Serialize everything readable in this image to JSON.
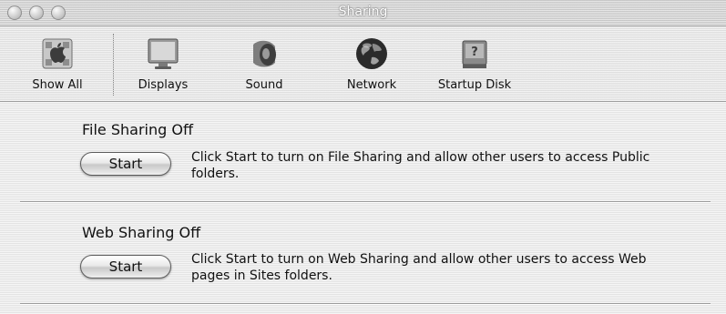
{
  "window": {
    "title": "Sharing"
  },
  "toolbar": {
    "items": [
      {
        "label": "Show All",
        "icon": "apple-icon"
      },
      {
        "label": "Displays",
        "icon": "monitor-icon"
      },
      {
        "label": "Sound",
        "icon": "speaker-icon"
      },
      {
        "label": "Network",
        "icon": "globe-icon"
      },
      {
        "label": "Startup Disk",
        "icon": "disk-icon"
      }
    ]
  },
  "file_sharing": {
    "title": "File Sharing Off",
    "button": "Start",
    "description": "Click Start to turn on File Sharing and allow other users to access Public folders."
  },
  "web_sharing": {
    "title": "Web Sharing Off",
    "button": "Start",
    "description": "Click Start to turn on Web Sharing and allow other users to access Web pages in Sites folders."
  }
}
